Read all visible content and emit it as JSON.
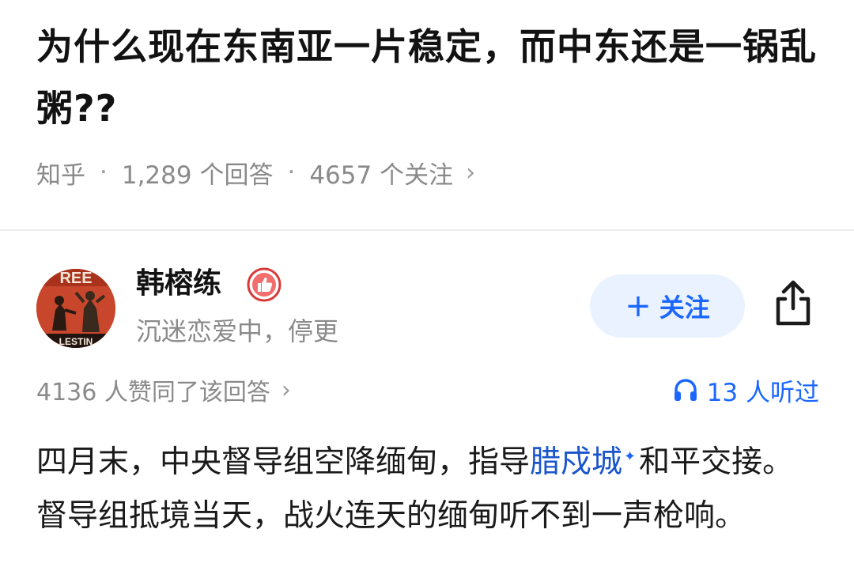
{
  "question": {
    "title": "为什么现在东南亚一片稳定，而中东还是一锅乱粥??",
    "source": "知乎",
    "answers": "1,289 个回答",
    "followers": "4657 个关注"
  },
  "author": {
    "name": "韩榕练",
    "bio": "沉迷恋爱中，停更",
    "follow_label": "关注",
    "badge_icon": "thumbs-up-badge-icon",
    "share_icon": "share-icon"
  },
  "answer": {
    "upvotes": "4136 人赞同了该回答",
    "listeners": "13 人听过",
    "text_part1": "四月末，中央督导组空降缅甸，指导",
    "link_text": "腊戍城",
    "text_part2": "和平交接。督导组抵境当天，战火连天的缅甸听不到一声枪响。"
  },
  "colors": {
    "accent": "#1a66ff",
    "follow_bg": "#eaf2ff",
    "meta_text": "#8a8a8a",
    "badge": "#d83a3a"
  }
}
